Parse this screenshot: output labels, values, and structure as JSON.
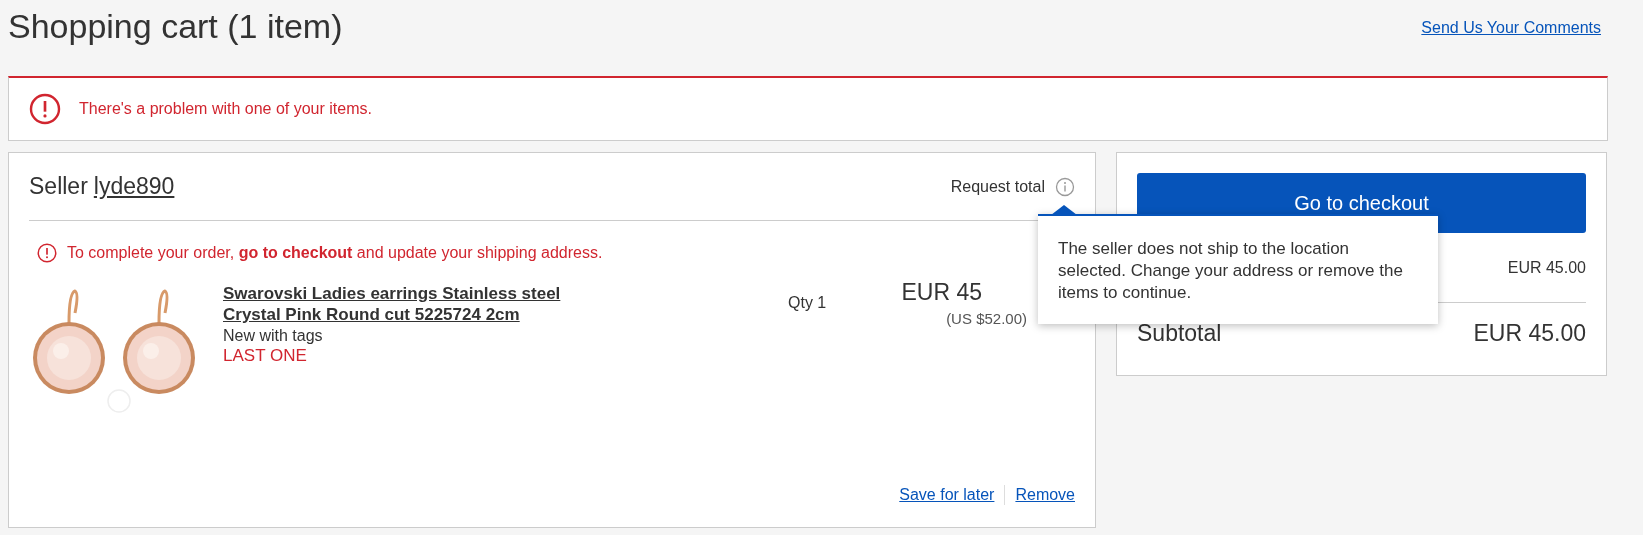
{
  "header": {
    "title": "Shopping cart (1 item)",
    "feedback_link": "Send Us Your Comments"
  },
  "alert": {
    "message": "There's a problem with one of your items."
  },
  "seller": {
    "label": "Seller",
    "name": "lyde890",
    "request_total": "Request total",
    "notice": {
      "before": "To complete your order, ",
      "link": "go to checkout",
      "after": " and update your shipping address."
    },
    "item": {
      "title": "Swarovski Ladies earrings Stainless steel Crystal Pink Round cut 5225724 2cm",
      "condition": "New with tags",
      "stock": "LAST ONE",
      "qty": "Qty 1",
      "price": "EUR 45",
      "price_usd": "(US $52.00)"
    },
    "actions": [
      "Save for later",
      "Remove"
    ]
  },
  "summary": {
    "checkout_button": "Go to checkout",
    "item_total": "EUR 45.00",
    "subtotal_label": "Subtotal",
    "subtotal": "EUR 45.00"
  },
  "tooltip": {
    "text": "The seller does not ship to the location selected. Change your address or remove the items to continue."
  }
}
